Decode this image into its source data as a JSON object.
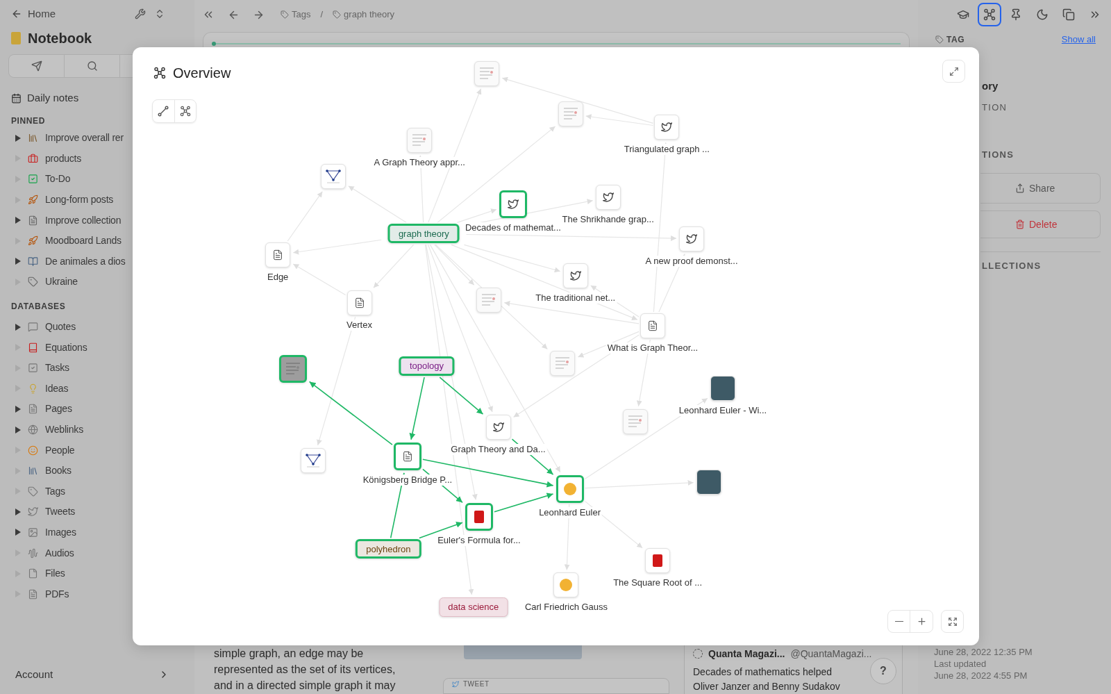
{
  "sidebar": {
    "back_label": "Home",
    "title": "Notebook",
    "daily_notes": "Daily notes",
    "pinned_heading": "PINNED",
    "pinned": [
      {
        "label": "Improve overall rer",
        "has_children": true
      },
      {
        "label": "products",
        "has_children": false
      },
      {
        "label": "To-Do",
        "has_children": false
      },
      {
        "label": "Long-form posts",
        "has_children": false
      },
      {
        "label": "Improve collection",
        "has_children": true
      },
      {
        "label": "Moodboard Lands",
        "has_children": false
      },
      {
        "label": "De animales a dios",
        "has_children": true
      },
      {
        "label": "Ukraine",
        "has_children": false
      }
    ],
    "databases_heading": "DATABASES",
    "databases": [
      {
        "label": "Quotes",
        "has_children": true
      },
      {
        "label": "Equations",
        "has_children": false
      },
      {
        "label": "Tasks",
        "has_children": false
      },
      {
        "label": "Ideas",
        "has_children": false
      },
      {
        "label": "Pages",
        "has_children": true
      },
      {
        "label": "Weblinks",
        "has_children": true
      },
      {
        "label": "People",
        "has_children": false
      },
      {
        "label": "Books",
        "has_children": false
      },
      {
        "label": "Tags",
        "has_children": false
      },
      {
        "label": "Tweets",
        "has_children": true
      },
      {
        "label": "Images",
        "has_children": true
      },
      {
        "label": "Audios",
        "has_children": false
      },
      {
        "label": "Files",
        "has_children": false
      },
      {
        "label": "PDFs",
        "has_children": false
      }
    ],
    "account": "Account"
  },
  "breadcrumb": [
    {
      "label": "Tags"
    },
    {
      "label": "graph theory"
    }
  ],
  "breadcrumb_separator": "/",
  "toolbar": [
    {
      "selected": false
    },
    {
      "selected": true
    },
    {
      "selected": false
    },
    {
      "selected": false
    },
    {
      "selected": false
    },
    {
      "selected": false
    }
  ],
  "dialog": {
    "title": "Overview",
    "nodes": [
      {
        "kind": "tag",
        "label": "graph theory",
        "highlighted": true,
        "color": "#1d6b50"
      },
      {
        "kind": "image",
        "highlighted": false
      },
      {
        "kind": "image",
        "highlighted": false
      },
      {
        "kind": "tweet",
        "label": "Triangulated graph ...",
        "highlighted": false
      },
      {
        "kind": "image",
        "label": "A Graph Theory appr...",
        "highlighted": false
      },
      {
        "kind": "triangle",
        "highlighted": false
      },
      {
        "kind": "tweet",
        "label": "Decades of mathemat...",
        "highlighted": true
      },
      {
        "kind": "tweet",
        "label": "The Shrikhande grap...",
        "highlighted": false
      },
      {
        "kind": "tweet",
        "label": "A new proof demonst...",
        "highlighted": false
      },
      {
        "kind": "doc",
        "label": "Edge",
        "highlighted": false
      },
      {
        "kind": "doc",
        "label": "Vertex",
        "highlighted": false
      },
      {
        "kind": "image",
        "highlighted": false
      },
      {
        "kind": "tweet",
        "label": "The traditional net...",
        "highlighted": false
      },
      {
        "kind": "doc",
        "label": "What is Graph Theor...",
        "highlighted": false
      },
      {
        "kind": "image",
        "highlighted": false
      },
      {
        "kind": "image",
        "highlighted": true
      },
      {
        "kind": "tag",
        "label": "topology",
        "highlighted": true,
        "color": "#7a1f86"
      },
      {
        "kind": "portrait",
        "label": "Leonhard Euler - Wi...",
        "highlighted": false
      },
      {
        "kind": "image",
        "highlighted": false
      },
      {
        "kind": "tweet",
        "label": "Graph Theory and Da...",
        "highlighted": false
      },
      {
        "kind": "triangle",
        "highlighted": false
      },
      {
        "kind": "doc",
        "label": "Königsberg Bridge P...",
        "highlighted": true
      },
      {
        "kind": "person",
        "label": "Leonhard Euler",
        "highlighted": true
      },
      {
        "kind": "portrait",
        "highlighted": false
      },
      {
        "kind": "book",
        "label": "Euler's Formula for...",
        "highlighted": true
      },
      {
        "kind": "tag",
        "label": "polyhedron",
        "highlighted": true,
        "color": "#6b4410"
      },
      {
        "kind": "book",
        "label": "The Square Root of ...",
        "highlighted": false
      },
      {
        "kind": "tag",
        "label": "data science",
        "highlighted": false,
        "color": "#9b1c3c"
      },
      {
        "kind": "person",
        "label": "Carl Friedrich Gauss",
        "highlighted": false
      }
    ],
    "edges": [
      {
        "highlighted": false
      },
      {
        "highlighted": false
      },
      {
        "highlighted": false
      },
      {
        "highlighted": false
      },
      {
        "highlighted": false
      },
      {
        "highlighted": false
      },
      {
        "highlighted": false
      },
      {
        "highlighted": false
      },
      {
        "highlighted": false
      },
      {
        "highlighted": false
      },
      {
        "highlighted": false
      },
      {
        "highlighted": false
      },
      {
        "highlighted": false
      },
      {
        "highlighted": false
      },
      {
        "highlighted": false
      },
      {
        "highlighted": false
      },
      {
        "highlighted": false
      },
      {
        "highlighted": false
      },
      {
        "highlighted": false
      },
      {
        "highlighted": false
      },
      {
        "highlighted": false
      },
      {
        "highlighted": false
      },
      {
        "highlighted": false
      },
      {
        "highlighted": false
      },
      {
        "highlighted": false
      },
      {
        "highlighted": false
      },
      {
        "highlighted": false
      },
      {
        "highlighted": false
      },
      {
        "highlighted": false
      },
      {
        "highlighted": false
      },
      {
        "highlighted": false
      },
      {
        "highlighted": false
      },
      {
        "highlighted": false
      },
      {
        "highlighted": true
      },
      {
        "highlighted": true
      },
      {
        "highlighted": true
      },
      {
        "highlighted": true
      },
      {
        "highlighted": true
      },
      {
        "highlighted": true
      },
      {
        "highlighted": true
      },
      {
        "highlighted": true
      },
      {
        "highlighted": true
      }
    ]
  },
  "right_panel": {
    "tag_heading": "TAG",
    "show_all": "Show all",
    "name_fragment": "ory",
    "section_1": "TION",
    "section_2": "TIONS",
    "share": "Share",
    "delete": "Delete",
    "section_3": "LLECTIONS",
    "created": "June 28, 2022 12:35 PM",
    "updated_label": "Last updated",
    "updated": "June 28, 2022 4:55 PM"
  },
  "content": {
    "paragraph": "simple graph, an edge may be\nrepresented as the set of its vertices,\nand in a directed simple graph it may",
    "tweet_card_label": "TWEET",
    "tweet": {
      "author": "Quanta Magazi...",
      "handle": "@QuantaMagazi...",
      "text": "Decades of mathematics helped\nOliver Janzer and Benny Sudakov"
    },
    "help": "?"
  }
}
